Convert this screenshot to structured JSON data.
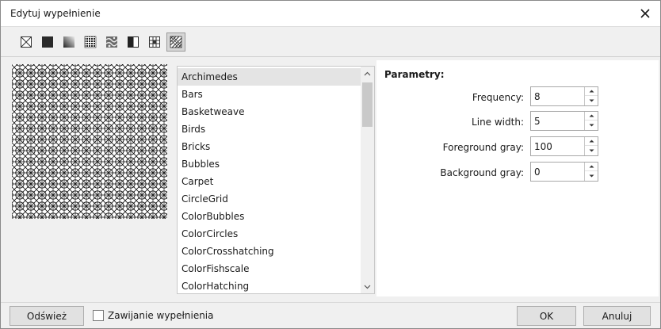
{
  "window": {
    "title": "Edytuj wypełnienie"
  },
  "toolbar": {
    "tools": [
      {
        "icon": "no-fill-icon"
      },
      {
        "icon": "uniform-fill-icon"
      },
      {
        "icon": "gradient-fill-icon"
      },
      {
        "icon": "two-color-pattern-icon"
      },
      {
        "icon": "bitmap-pattern-icon"
      },
      {
        "icon": "texture-fill-icon"
      },
      {
        "icon": "vector-pattern-icon"
      },
      {
        "icon": "postscript-fill-icon"
      }
    ],
    "active_index": 7
  },
  "fill_list": {
    "items": [
      "Archimedes",
      "Bars",
      "Basketweave",
      "Birds",
      "Bricks",
      "Bubbles",
      "Carpet",
      "CircleGrid",
      "ColorBubbles",
      "ColorCircles",
      "ColorCrosshatching",
      "ColorFishscale",
      "ColorHatching"
    ],
    "selected_index": 0
  },
  "params": {
    "title": "Parametry:",
    "frequency_label": "Frequency:",
    "frequency_value": "8",
    "line_width_label": "Line width:",
    "line_width_value": "5",
    "foreground_gray_label": "Foreground gray:",
    "foreground_gray_value": "100",
    "background_gray_label": "Background gray:",
    "background_gray_value": "0"
  },
  "footer": {
    "refresh_label": "Odśwież",
    "wrap_checkbox_label": "Zawijanie wypełnienia",
    "wrap_checked": false,
    "ok_label": "OK",
    "cancel_label": "Anuluj"
  }
}
